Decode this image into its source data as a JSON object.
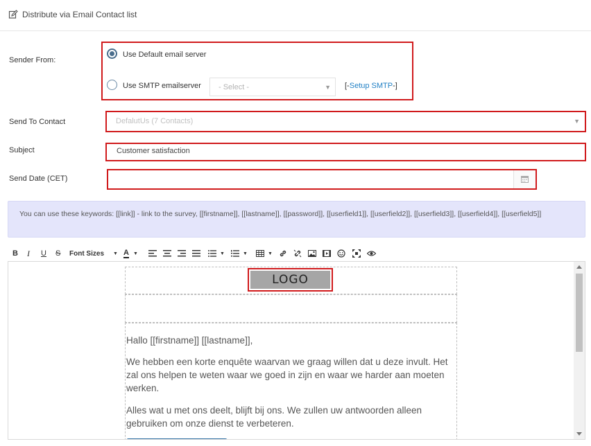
{
  "header": {
    "title": "Distribute via Email Contact list",
    "icon": "edit-icon"
  },
  "sender": {
    "label": "Sender From:",
    "default_option": "Use Default email server",
    "smtp_option": "Use SMTP emailserver",
    "selected": "default",
    "smtp_select_placeholder": "- Select -",
    "setup_prefix": "[-",
    "setup_link": "Setup SMTP",
    "setup_suffix": "-]"
  },
  "send_to": {
    "label": "Send To Contact",
    "value": "DefalutUs (7 Contacts)"
  },
  "subject": {
    "label": "Subject",
    "value": "Customer satisfaction"
  },
  "send_date": {
    "label": "Send Date (CET)",
    "value": "",
    "icon": "calendar-icon"
  },
  "info": {
    "text": "You can use these keywords: [[link]] - link to the survey, [[firstname]], [[lastname]], [[password]], [[userfield1]], [[userfield2]], [[userfield3]], [[userfield4]], [[userfield5]]"
  },
  "toolbar": {
    "font_sizes_label": "Font Sizes",
    "buttons": [
      "bold",
      "italic",
      "underline",
      "strikethrough",
      "font-sizes",
      "text-color",
      "align-left",
      "align-center",
      "align-right",
      "justify",
      "bullet-list",
      "numbered-list",
      "table",
      "link",
      "unlink",
      "image",
      "video",
      "emoji",
      "fullscreen",
      "preview"
    ]
  },
  "editor": {
    "logo_text": "LOGO",
    "greeting": "Hallo [[firstname]] [[lastname]],",
    "paragraph1": "We hebben een korte enquête waarvan we graag willen dat u deze invult. Het zal ons helpen te weten waar we goed in zijn en waar we harder aan moeten werken.",
    "paragraph2": "Alles wat u met ons deelt, blijft bij ons. We zullen uw antwoorden alleen gebruiken om onze dienst te verbeteren."
  },
  "colors": {
    "highlight": "#d0191b",
    "link": "#1f7fc4",
    "info_bg": "#e4e5fb",
    "radio": "#4a6d8c",
    "cta": "#2f6fa3"
  }
}
